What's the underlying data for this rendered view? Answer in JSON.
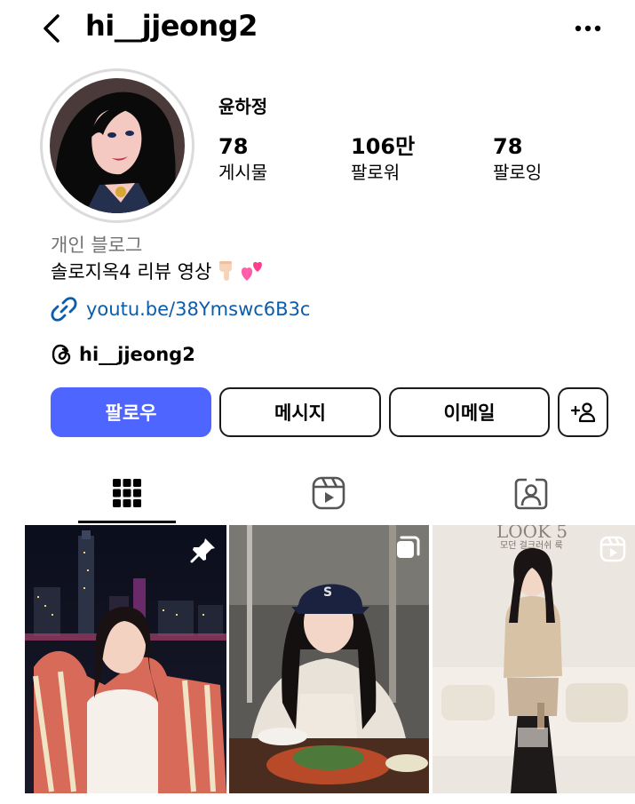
{
  "header": {
    "username": "hi__jjeong2",
    "back_icon": "chevron-left-icon",
    "more_icon": "more-dots-icon"
  },
  "profile": {
    "display_name": "윤하정",
    "stats": [
      {
        "value": "78",
        "label": "게시물"
      },
      {
        "value": "106만",
        "label": "팔로워"
      },
      {
        "value": "78",
        "label": "팔로잉"
      }
    ],
    "category": "개인 블로그",
    "bio": "솔로지옥4 리뷰 영상",
    "bio_emojis": [
      "pointing-down-hand-icon",
      "two-hearts-icon"
    ],
    "link": "youtu.be/38Ymswc6B3c",
    "threads_handle": "hi__jjeong2"
  },
  "actions": {
    "follow": "팔로우",
    "message": "메시지",
    "email": "이메일",
    "add_user_label": "+"
  },
  "tabs": [
    {
      "name": "posts-grid",
      "icon": "grid-icon",
      "active": true
    },
    {
      "name": "reels",
      "icon": "reels-icon",
      "active": false
    },
    {
      "name": "tagged",
      "icon": "tagged-person-icon",
      "active": false
    }
  ],
  "posts": [
    {
      "badge": "pin-icon",
      "description": "photo"
    },
    {
      "badge": "multi-photo-icon",
      "description": "photo"
    },
    {
      "badge": "reels-icon",
      "description": "video",
      "overlay_text": "LOOK 5",
      "overlay_subtext": "모던 걸크러쉬 룩"
    }
  ],
  "colors": {
    "accent": "#4f65ff",
    "link": "#0b5cab",
    "muted": "#737373"
  }
}
